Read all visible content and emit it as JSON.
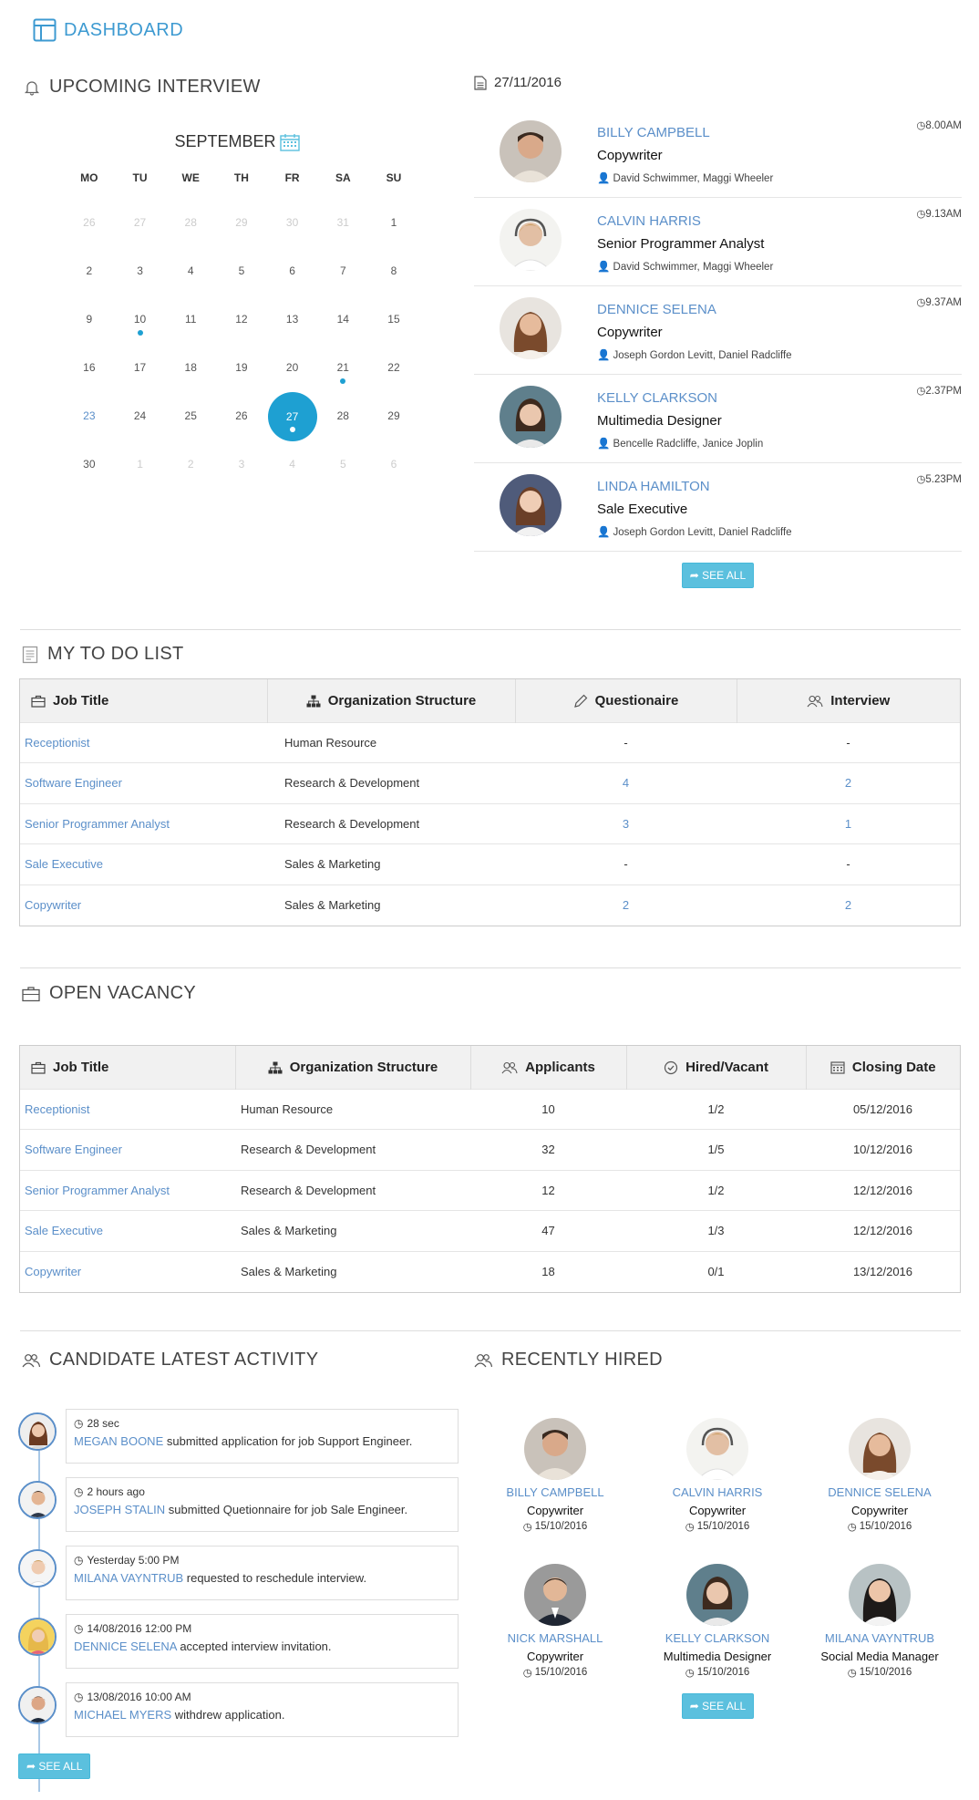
{
  "header": {
    "title": "DASHBOARD"
  },
  "upcoming": {
    "title": "UPCOMING INTERVIEW",
    "month": "SEPTEMBER",
    "weekdays": [
      "MO",
      "TU",
      "WE",
      "TH",
      "FR",
      "SA",
      "SU"
    ],
    "weeks": [
      [
        "26",
        "27",
        "28",
        "29",
        "30",
        "31",
        "1"
      ],
      [
        "2",
        "3",
        "4",
        "5",
        "6",
        "7",
        "8"
      ],
      [
        "9",
        "10",
        "11",
        "12",
        "13",
        "14",
        "15"
      ],
      [
        "16",
        "17",
        "18",
        "19",
        "20",
        "21",
        "22"
      ],
      [
        "23",
        "24",
        "25",
        "26",
        "27",
        "28",
        "29"
      ],
      [
        "30",
        "1",
        "2",
        "3",
        "4",
        "5",
        "6"
      ]
    ]
  },
  "interviews": {
    "date": "27/11/2016",
    "items": [
      {
        "name": "BILLY CAMPBELL",
        "role": "Copywriter",
        "people": "David Schwimmer, Maggi Wheeler",
        "time": "8.00AM"
      },
      {
        "name": "CALVIN HARRIS",
        "role": "Senior Programmer Analyst",
        "people": "David Schwimmer, Maggi Wheeler",
        "time": "9.13AM"
      },
      {
        "name": "DENNICE SELENA",
        "role": "Copywriter",
        "people": "Joseph Gordon Levitt, Daniel Radcliffe",
        "time": "9.37AM"
      },
      {
        "name": "KELLY CLARKSON",
        "role": "Multimedia Designer",
        "people": "Bencelle Radcliffe, Janice Joplin",
        "time": "2.37PM"
      },
      {
        "name": "LINDA HAMILTON",
        "role": "Sale Executive",
        "people": "Joseph Gordon Levitt, Daniel Radcliffe",
        "time": "5.23PM"
      }
    ],
    "see_all": "SEE ALL"
  },
  "todo": {
    "title": "MY TO DO LIST",
    "headers": [
      "Job Title",
      "Organization Structure",
      "Questionaire",
      "Interview"
    ],
    "rows": [
      [
        "Receptionist",
        "Human Resource",
        "-",
        "-"
      ],
      [
        "Software Engineer",
        "Research & Development",
        "4",
        "2"
      ],
      [
        "Senior Programmer Analyst",
        "Research & Development",
        "3",
        "1"
      ],
      [
        "Sale Executive",
        "Sales & Marketing",
        "-",
        "-"
      ],
      [
        "Copywriter",
        "Sales & Marketing",
        "2",
        "2"
      ]
    ]
  },
  "vacancy": {
    "title": "OPEN VACANCY",
    "headers": [
      "Job Title",
      "Organization Structure",
      "Applicants",
      "Hired/Vacant",
      "Closing Date"
    ],
    "rows": [
      [
        "Receptionist",
        "Human Resource",
        "10",
        "1/2",
        "05/12/2016"
      ],
      [
        "Software Engineer",
        "Research & Development",
        "32",
        "1/5",
        "10/12/2016"
      ],
      [
        "Senior Programmer Analyst",
        "Research & Development",
        "12",
        "1/2",
        "12/12/2016"
      ],
      [
        "Sale Executive",
        "Sales & Marketing",
        "47",
        "1/3",
        "12/12/2016"
      ],
      [
        "Copywriter",
        "Sales & Marketing",
        "18",
        "0/1",
        "13/12/2016"
      ]
    ]
  },
  "activity": {
    "title": "CANDIDATE LATEST ACTIVITY",
    "items": [
      {
        "time": "28 sec",
        "name": "MEGAN BOONE",
        "text": " submitted application for job Support Engineer."
      },
      {
        "time": "2 hours ago",
        "name": "JOSEPH STALIN",
        "text": " submitted Quetionnaire for job Sale Engineer."
      },
      {
        "time": "Yesterday 5:00 PM",
        "name": "MILANA VAYNTRUB",
        "text": " requested to reschedule interview."
      },
      {
        "time": "14/08/2016 12:00 PM",
        "name": "DENNICE SELENA",
        "text": " accepted interview invitation."
      },
      {
        "time": "13/08/2016 10:00 AM",
        "name": "MICHAEL MYERS",
        "text": " withdrew application."
      }
    ],
    "see_all": "SEE ALL"
  },
  "hired": {
    "title": "RECENTLY HIRED",
    "items": [
      {
        "name": "BILLY CAMPBELL",
        "role": "Copywriter",
        "date": "15/10/2016"
      },
      {
        "name": "CALVIN HARRIS",
        "role": "Copywriter",
        "date": "15/10/2016"
      },
      {
        "name": "DENNICE SELENA",
        "role": "Copywriter",
        "date": "15/10/2016"
      },
      {
        "name": "NICK MARSHALL",
        "role": "Copywriter",
        "date": "15/10/2016"
      },
      {
        "name": "KELLY CLARKSON",
        "role": "Multimedia Designer",
        "date": "15/10/2016"
      },
      {
        "name": "MILANA VAYNTRUB",
        "role": "Social Media Manager",
        "date": "15/10/2016"
      }
    ],
    "see_all": "SEE ALL"
  },
  "colors": {
    "accent": "#1ea0d2",
    "link": "#5b8fc9",
    "button": "#5bc0de"
  },
  "icons": [
    "layout-icon",
    "bell-icon",
    "calendar-icon",
    "document-icon",
    "clock-icon",
    "user-icon",
    "clipboard-icon",
    "briefcase-icon",
    "sitemap-icon",
    "pencil-icon",
    "users-icon",
    "check-circle-icon",
    "share-icon"
  ]
}
